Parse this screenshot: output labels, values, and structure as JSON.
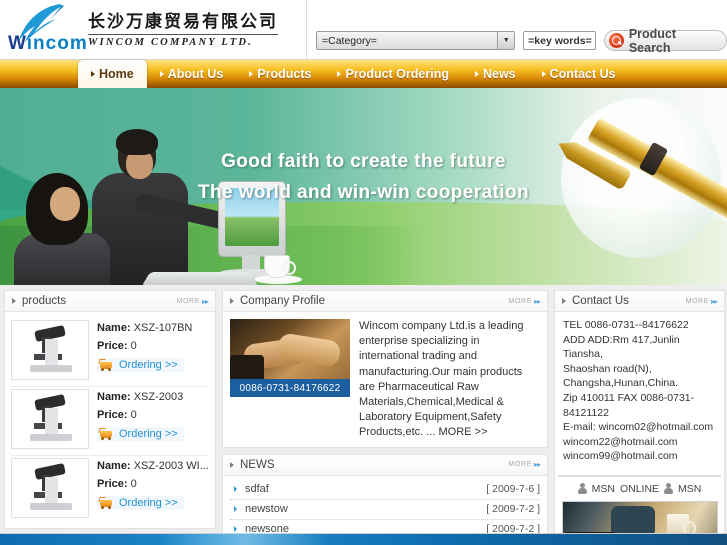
{
  "header": {
    "logo_word_w": "W",
    "logo_word_rest": "incom",
    "company_cn": "长沙万康贸易有限公司",
    "company_en": "WINCOM COMPANY LTD.",
    "search": {
      "category_value": "=Category=",
      "keywords_value": "=key words=",
      "search_button_label": "Product Search",
      "search_icon": "magnifier-icon",
      "dropdown_icon": "chevron-down-icon"
    }
  },
  "nav": {
    "items": [
      {
        "label": "Home",
        "active": true
      },
      {
        "label": "About Us",
        "active": false
      },
      {
        "label": "Products",
        "active": false
      },
      {
        "label": "Product Ordering",
        "active": false
      },
      {
        "label": "News",
        "active": false
      },
      {
        "label": "Contact Us",
        "active": false
      }
    ]
  },
  "banner": {
    "line1": "Good faith to create the future",
    "line2": "The world and win-win cooperation"
  },
  "products_panel": {
    "title": "products",
    "more_label": "MORE",
    "items": [
      {
        "name_label": "Name:",
        "name": "XSZ-107BN",
        "price_label": "Price:",
        "price": "0",
        "order_label": "Ordering >>"
      },
      {
        "name_label": "Name:",
        "name": "XSZ-2003",
        "price_label": "Price:",
        "price": "0",
        "order_label": "Ordering >>"
      },
      {
        "name_label": "Name:",
        "name": "XSZ-2003 WI...",
        "price_label": "Price:",
        "price": "0",
        "order_label": "Ordering >>"
      }
    ]
  },
  "company_panel": {
    "title": "Company Profile",
    "more_label": "MORE",
    "phone": "0086-0731-84176622",
    "text": "Wincom company Ltd.is a leading enterprise specializing in international trading and manufacturing.Our main products are Pharmaceutical Raw Materials,Chemical,Medical & Laboratory Equipment,Safety Products,etc. ... MORE >>"
  },
  "news_panel": {
    "title": "NEWS",
    "more_label": "MORE",
    "items": [
      {
        "title": "sdfaf",
        "date": "[ 2009-7-6 ]"
      },
      {
        "title": "newstow",
        "date": "[ 2009-7-2 ]"
      },
      {
        "title": "newsone",
        "date": "[ 2009-7-2 ]"
      }
    ]
  },
  "contact_panel": {
    "title": "Contact Us",
    "more_label": "MORE",
    "lines": [
      "TEL 0086-0731--84176622",
      "ADD ADD:Rm 417,Junlin Tiansha,",
      "Shaoshan road(N),",
      "Changsha,Hunan,China.",
      "Zip 410011 FAX 0086-0731-",
      "84121122",
      "E-mail: wincom02@hotmail.com",
      "wincom22@hotmail.com",
      "wincom99@hotmail.com"
    ],
    "msn_left_label": "MSN",
    "msn_online_label": "ONLINE",
    "msn_right_label": "MSN"
  },
  "colors": {
    "nav_gold": "#f6c024",
    "nav_brown": "#8c4a04",
    "banner_green": "#3fae8d",
    "link_blue": "#1f8fd6",
    "phone_bar_blue": "#1c5fa0",
    "footer_blue": "#1f8ccd"
  }
}
